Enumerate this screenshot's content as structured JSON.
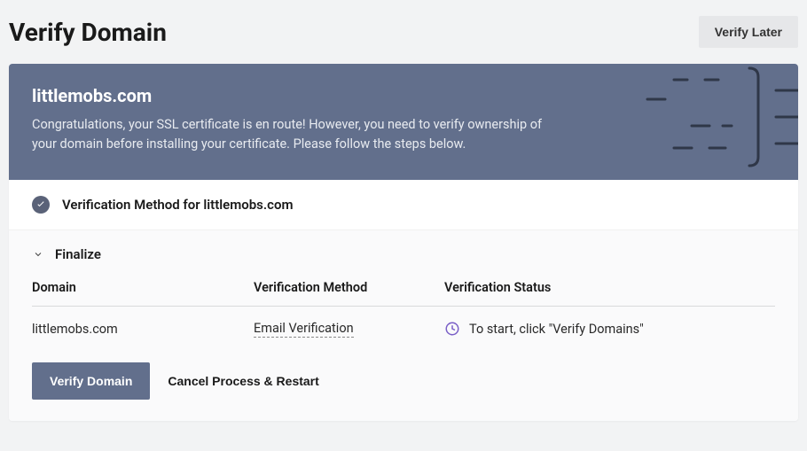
{
  "header": {
    "title": "Verify Domain",
    "verify_later": "Verify Later"
  },
  "banner": {
    "domain": "littlemobs.com",
    "description": "Congratulations, your SSL certificate is en route! However, you need to verify ownership of your domain before installing your certificate. Please follow the steps below."
  },
  "verification": {
    "method_label": "Verification Method for littlemobs.com"
  },
  "finalize": {
    "title": "Finalize",
    "columns": {
      "domain": "Domain",
      "method": "Verification Method",
      "status": "Verification Status"
    },
    "row": {
      "domain": "littlemobs.com",
      "method": "Email Verification",
      "status": "To start, click \"Verify Domains\""
    },
    "actions": {
      "verify": "Verify Domain",
      "cancel": "Cancel Process & Restart"
    }
  }
}
